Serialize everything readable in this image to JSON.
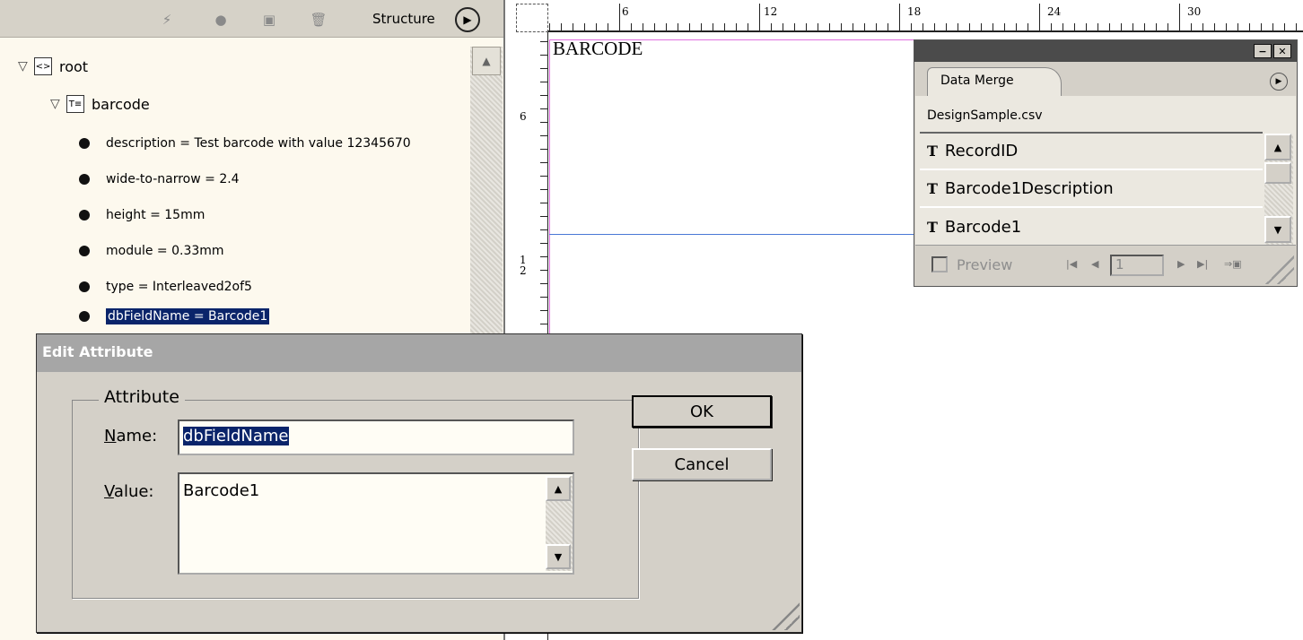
{
  "structure": {
    "toolbar_label": "Structure",
    "tree": {
      "root_label": "root",
      "child_label": "barcode",
      "attributes": [
        "description = Test barcode with value 12345670",
        "wide-to-narrow = 2.4",
        "height = 15mm",
        "module = 0.33mm",
        "type = Interleaved2of5",
        "dbFieldName = Barcode1"
      ],
      "selected_index": 5
    }
  },
  "ruler": {
    "top_labels": [
      "6",
      "12",
      "18",
      "24",
      "30"
    ],
    "left_labels": [
      "6",
      "1\n2"
    ]
  },
  "document": {
    "frame_text": "BARCODE"
  },
  "data_merge": {
    "tab_label": "Data Merge",
    "file_name": "DesignSample.csv",
    "fields": [
      "RecordID",
      "Barcode1Description",
      "Barcode1"
    ],
    "field_icon": "T",
    "preview_label": "Preview",
    "record_number": "1"
  },
  "dialog": {
    "title": "Edit Attribute",
    "group_label": "Attribute",
    "name_label_u": "N",
    "name_label_rest": "ame:",
    "name_value": "dbFieldName",
    "value_label_u": "V",
    "value_label_rest": "alue:",
    "value_value": "Barcode1",
    "ok_label": "OK",
    "cancel_label": "Cancel"
  }
}
